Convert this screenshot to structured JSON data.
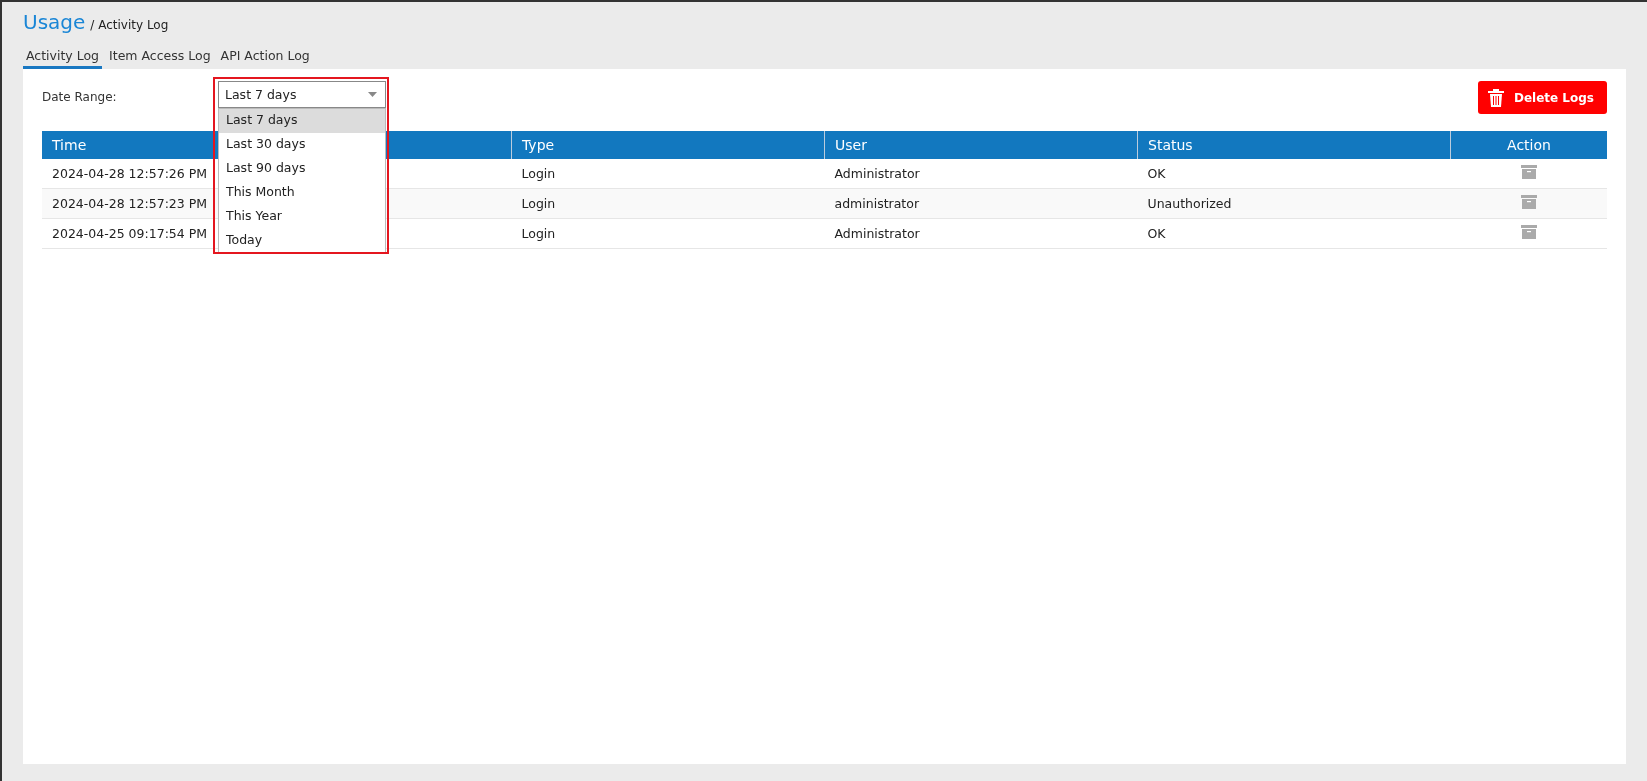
{
  "breadcrumb": {
    "title": "Usage",
    "trail": "/ Activity Log"
  },
  "tabs": [
    {
      "label": "Activity Log",
      "selected": true
    },
    {
      "label": "Item Access Log",
      "selected": false
    },
    {
      "label": "API Action Log",
      "selected": false
    }
  ],
  "date_range": {
    "label": "Date Range:",
    "value": "Last 7 days",
    "expanded": true,
    "options": [
      {
        "label": "Last 7 days",
        "selected": true
      },
      {
        "label": "Last 30 days",
        "selected": false
      },
      {
        "label": "Last 90 days",
        "selected": false
      },
      {
        "label": "This Month",
        "selected": false
      },
      {
        "label": "This Year",
        "selected": false
      },
      {
        "label": "Today",
        "selected": false
      }
    ]
  },
  "delete_button": "Delete Logs",
  "table": {
    "columns": [
      "Time",
      "Type",
      "User",
      "Status",
      "Action"
    ],
    "rows": [
      {
        "time": "2024-04-28 12:57:26 PM",
        "type": "Login",
        "user": "Administrator",
        "status": "OK"
      },
      {
        "time": "2024-04-28 12:57:23 PM",
        "type": "Login",
        "user": "administrator",
        "status": "Unauthorized"
      },
      {
        "time": "2024-04-25 09:17:54 PM",
        "type": "Login",
        "user": "Administrator",
        "status": "OK"
      }
    ]
  }
}
